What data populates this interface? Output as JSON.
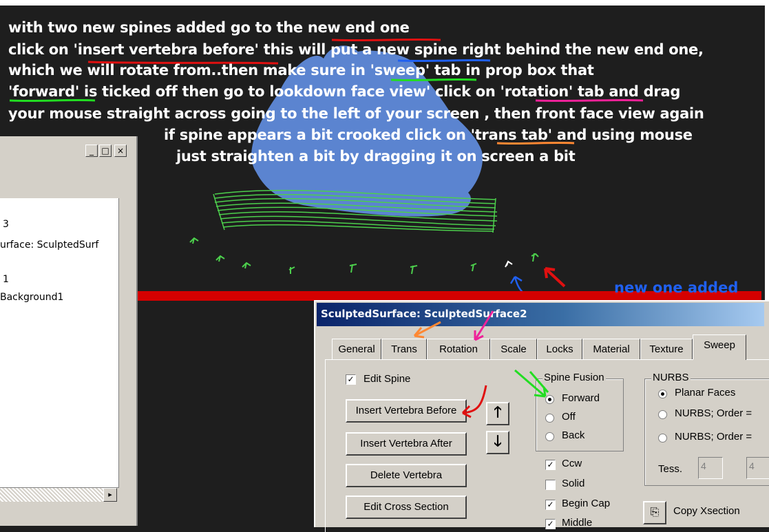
{
  "instructions": {
    "line1": "with two new spines added go to the new end one",
    "line2": "click on 'insert vertebra before' this will put a new spine right behind the new end one,",
    "line3": "which we will rotate from..then make sure in 'sweep' tab in prop box that",
    "line4": "'forward' is ticked off then go to lookdown face view' click on 'rotation' tab and drag",
    "line5": "your mouse straight across going to the left of your screen , then front face view again",
    "line6": "if spine appears a bit crooked click on 'trans tab' and using mouse",
    "line7": "just straighten a bit by dragging it on screen a bit"
  },
  "annotation": {
    "new_one_added": "new one added"
  },
  "left_window": {
    "buttons": {
      "minimize": "_",
      "maximize": "□",
      "close": "×"
    },
    "lines": [
      "3",
      "urface:  SculptedSurf",
      "1",
      "Background1"
    ],
    "scroll_right": "▸"
  },
  "dialog": {
    "title": "SculptedSurface:  SculptedSurface2",
    "tabs": [
      "General",
      "Trans",
      "Rotation",
      "Scale",
      "Locks",
      "Material",
      "Texture",
      "Sweep"
    ],
    "active_tab": "Sweep",
    "edit_spine": {
      "label": "Edit Spine",
      "checked": true
    },
    "buttons": {
      "insert_before": "Insert Vertebra Before",
      "insert_after": "Insert Vertebra After",
      "delete": "Delete Vertebra",
      "edit_cross": "Edit Cross Section",
      "up": "🡑",
      "down": "🡓"
    },
    "spine_fusion": {
      "title": "Spine Fusion",
      "options": [
        "Forward",
        "Off",
        "Back"
      ],
      "selected": "Forward"
    },
    "checks": [
      {
        "label": "Ccw",
        "checked": true
      },
      {
        "label": "Solid",
        "checked": false
      },
      {
        "label": "Begin Cap",
        "checked": true
      },
      {
        "label": "Middle",
        "checked": true
      }
    ],
    "nurbs": {
      "title": "NURBS",
      "options": [
        "Planar Faces",
        "NURBS;  Order =",
        "NURBS;  Order ="
      ],
      "selected": "Planar Faces",
      "tess_label": "Tess.",
      "tess_values": [
        "4",
        "4"
      ]
    },
    "copy_xsection": "Copy Xsection"
  },
  "colors": {
    "background": "#1e1e1e",
    "red_bar": "#d40000",
    "blue_blob": "#5b84d0",
    "spine_green": "#4ccf4c",
    "title_blue": "#0a246a",
    "annotation_red": "#e01010",
    "annotation_blue": "#2060f0",
    "annotation_green": "#22dd22",
    "annotation_orange": "#ff8833",
    "annotation_pink": "#ee2299"
  }
}
